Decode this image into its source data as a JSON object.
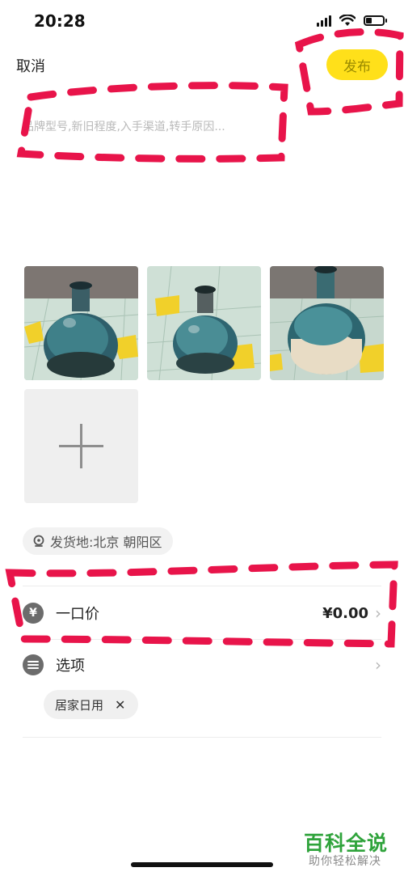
{
  "status_bar": {
    "time": "20:28"
  },
  "header": {
    "cancel_label": "取消",
    "publish_label": "发布"
  },
  "description": {
    "placeholder": "品牌型号,新旧程度,入手渠道,转手原因..."
  },
  "photos": [
    {
      "name": "vase-photo-1"
    },
    {
      "name": "vase-photo-2"
    },
    {
      "name": "vase-photo-3"
    }
  ],
  "location": {
    "label": "发货地:北京 朝阳区"
  },
  "price_row": {
    "icon": "¥",
    "label": "一口价",
    "value": "¥0.00"
  },
  "options_row": {
    "label": "选项"
  },
  "tags": [
    {
      "label": "居家日用"
    }
  ],
  "watermark": {
    "title": "百科全说",
    "subtitle": "助你轻松解决"
  },
  "colors": {
    "accent_yellow": "#ffe01a",
    "annotation_red": "#e8144a",
    "watermark_green": "#2fa33b"
  }
}
